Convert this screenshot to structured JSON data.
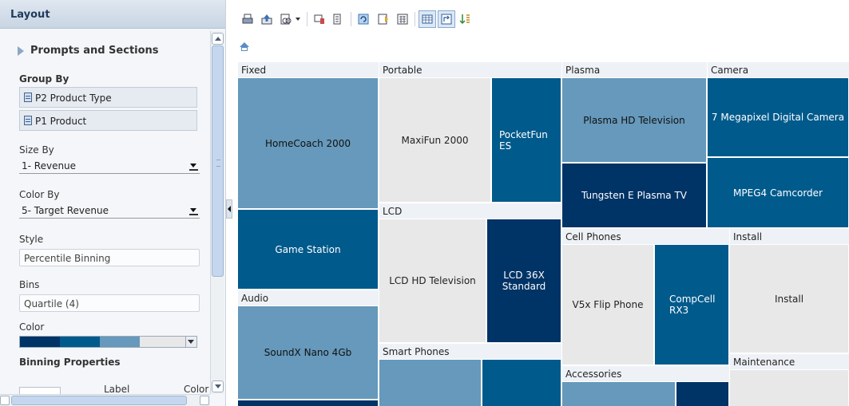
{
  "panel": {
    "title": "Layout",
    "prompts_label": "Prompts and Sections",
    "group_by_label": "Group By",
    "group_by_items": [
      "P2 Product Type",
      "P1 Product"
    ],
    "size_by_label": "Size By",
    "size_by_value": "1- Revenue",
    "color_by_label": "Color By",
    "color_by_value": "5- Target Revenue",
    "style_label": "Style",
    "style_value": "Percentile Binning",
    "bins_label": "Bins",
    "bins_value": "Quartile (4)",
    "color_label": "Color",
    "color_ramp": [
      "#003366",
      "#005a8c",
      "#6699bb",
      "#e8e8e8"
    ],
    "binning_label": "Binning Properties",
    "col_label": "Label",
    "col_color": "Color"
  },
  "toolbar": {
    "icons": [
      "print-icon",
      "export-icon",
      "view-options-icon",
      "prompt-icon",
      "edit-icon",
      "refresh-icon",
      "properties-icon",
      "calculator-icon",
      "table-view-icon",
      "pivot-icon",
      "sort-icon"
    ]
  },
  "treemap": {
    "quartile_colors": {
      "q1": "#e8e8e8",
      "q2": "#6699bb",
      "q3": "#005a8c",
      "q4": "#003366"
    },
    "groups": {
      "fixed": "Fixed",
      "portable": "Portable",
      "lcd": "LCD",
      "smart_phones": "Smart Phones",
      "audio": "Audio",
      "plasma": "Plasma",
      "cell_phones": "Cell Phones",
      "accessories": "Accessories",
      "camera": "Camera",
      "install": "Install",
      "maintenance": "Maintenance"
    },
    "tiles": {
      "homecoach": "HomeCoach 2000",
      "game_station": "Game Station",
      "soundx": "SoundX Nano 4Gb",
      "maxifun": "MaxiFun 2000",
      "pocketfun": "PocketFun ES",
      "lcd_hd": "LCD HD Television",
      "lcd_36x": "LCD 36X Standard",
      "plasma_hd": "Plasma HD Television",
      "tungsten": "Tungsten E Plasma TV",
      "v5x": "V5x Flip Phone",
      "compcell": "CompCell RX3",
      "camera_7mp": "7 Megapixel Digital Camera",
      "mpeg4": "MPEG4 Camcorder",
      "install": "Install"
    }
  }
}
